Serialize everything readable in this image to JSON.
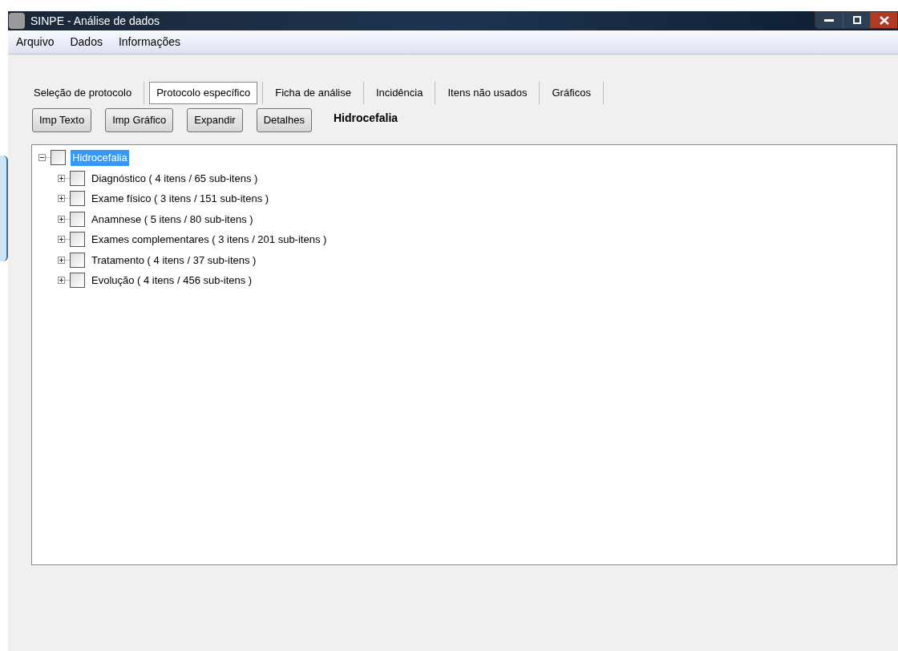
{
  "window": {
    "title": "SINPE - Análise de dados"
  },
  "menu": [
    "Arquivo",
    "Dados",
    "Informações"
  ],
  "tabs": [
    {
      "label": "Seleção de protocolo",
      "selected": false
    },
    {
      "label": "Protocolo específico",
      "selected": true
    },
    {
      "label": "Ficha de análise",
      "selected": false
    },
    {
      "label": "Incidência",
      "selected": false
    },
    {
      "label": "Itens não usados",
      "selected": false
    },
    {
      "label": "Gráficos",
      "selected": false
    }
  ],
  "buttons": [
    "Imp Texto",
    "Imp Gráfico",
    "Expandir",
    "Detalhes"
  ],
  "protocol_name": "Hidrocefalia",
  "tree": [
    {
      "label": "Hidrocefalia",
      "expanded": true,
      "checked": false,
      "selected": true,
      "children": [
        {
          "label": "Diagnóstico ( 4 itens / 65 sub-itens )",
          "expanded": false,
          "checked": false,
          "selected": false
        },
        {
          "label": "Exame físico ( 3 itens / 151 sub-itens )",
          "expanded": false,
          "checked": false,
          "selected": false
        },
        {
          "label": "Anamnese ( 5 itens / 80 sub-itens )",
          "expanded": false,
          "checked": false,
          "selected": false
        },
        {
          "label": "Exames complementares ( 3 itens / 201 sub-itens )",
          "expanded": false,
          "checked": false,
          "selected": false
        },
        {
          "label": "Tratamento ( 4 itens / 37 sub-itens )",
          "expanded": false,
          "checked": false,
          "selected": false
        },
        {
          "label": "Evolução ( 4 itens / 456 sub-itens )",
          "expanded": false,
          "checked": false,
          "selected": false
        }
      ]
    }
  ]
}
